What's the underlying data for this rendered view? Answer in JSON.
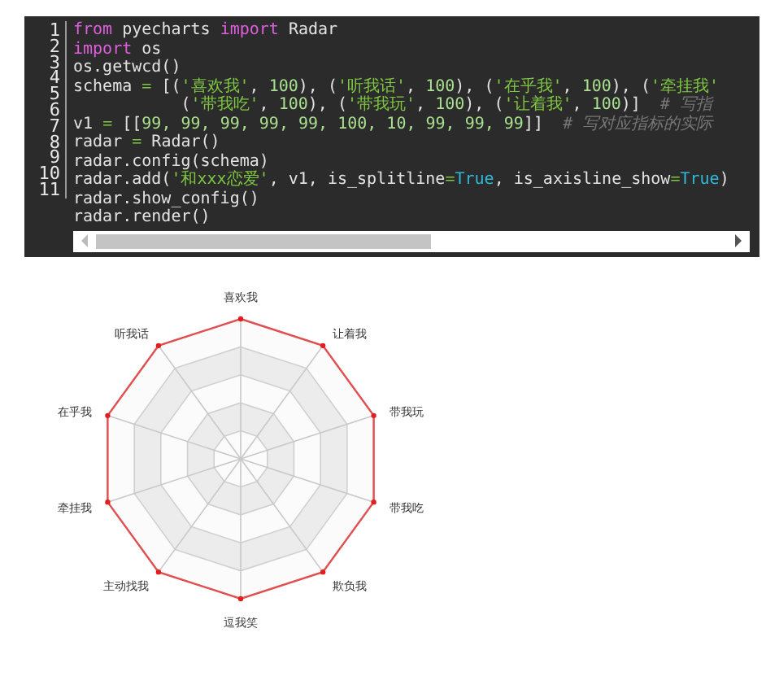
{
  "code_editor": {
    "line_numbers": [
      "1",
      "2",
      "3",
      "4",
      "5",
      "6",
      "7",
      "8",
      "9",
      "10",
      "11"
    ],
    "lines": [
      {
        "tokens": [
          {
            "text": "from",
            "kind": "keyword"
          },
          {
            "text": " pyecharts ",
            "kind": "plain"
          },
          {
            "text": "import",
            "kind": "keyword"
          },
          {
            "text": " Radar",
            "kind": "plain"
          }
        ]
      },
      {
        "tokens": [
          {
            "text": "import",
            "kind": "keyword"
          },
          {
            "text": " os",
            "kind": "plain"
          }
        ]
      },
      {
        "tokens": [
          {
            "text": "os.getwcd()",
            "kind": "plain"
          }
        ]
      },
      {
        "tokens": [
          {
            "text": "schema ",
            "kind": "plain"
          },
          {
            "text": "=",
            "kind": "operator"
          },
          {
            "text": " [(",
            "kind": "plain"
          },
          {
            "text": "'喜欢我'",
            "kind": "string"
          },
          {
            "text": ", ",
            "kind": "plain"
          },
          {
            "text": "100",
            "kind": "number"
          },
          {
            "text": "), (",
            "kind": "plain"
          },
          {
            "text": "'听我话'",
            "kind": "string"
          },
          {
            "text": ", ",
            "kind": "plain"
          },
          {
            "text": "100",
            "kind": "number"
          },
          {
            "text": "), (",
            "kind": "plain"
          },
          {
            "text": "'在乎我'",
            "kind": "string"
          },
          {
            "text": ", ",
            "kind": "plain"
          },
          {
            "text": "100",
            "kind": "number"
          },
          {
            "text": "), (",
            "kind": "plain"
          },
          {
            "text": "'牵挂我'",
            "kind": "string"
          }
        ]
      },
      {
        "tokens": [
          {
            "text": "           (",
            "kind": "plain"
          },
          {
            "text": "'带我吃'",
            "kind": "string"
          },
          {
            "text": ", ",
            "kind": "plain"
          },
          {
            "text": "100",
            "kind": "number"
          },
          {
            "text": "), (",
            "kind": "plain"
          },
          {
            "text": "'带我玩'",
            "kind": "string"
          },
          {
            "text": ", ",
            "kind": "plain"
          },
          {
            "text": "100",
            "kind": "number"
          },
          {
            "text": "), (",
            "kind": "plain"
          },
          {
            "text": "'让着我'",
            "kind": "string"
          },
          {
            "text": ", ",
            "kind": "plain"
          },
          {
            "text": "100",
            "kind": "number"
          },
          {
            "text": ")]  ",
            "kind": "plain"
          },
          {
            "text": "# 写指",
            "kind": "comment"
          }
        ]
      },
      {
        "tokens": [
          {
            "text": "v1 ",
            "kind": "plain"
          },
          {
            "text": "=",
            "kind": "operator"
          },
          {
            "text": " [[",
            "kind": "plain"
          },
          {
            "text": "99, 99, 99, 99, 99, 100, 10, 99, 99, 99",
            "kind": "number"
          },
          {
            "text": "]]  ",
            "kind": "plain"
          },
          {
            "text": "# 写对应指标的实际",
            "kind": "comment"
          }
        ]
      },
      {
        "tokens": [
          {
            "text": "radar ",
            "kind": "plain"
          },
          {
            "text": "=",
            "kind": "operator"
          },
          {
            "text": " Radar()",
            "kind": "plain"
          }
        ]
      },
      {
        "tokens": [
          {
            "text": "radar.config(schema)",
            "kind": "plain"
          }
        ]
      },
      {
        "tokens": [
          {
            "text": "radar.add(",
            "kind": "plain"
          },
          {
            "text": "'和xxx恋爱'",
            "kind": "string"
          },
          {
            "text": ", v1, is_splitline",
            "kind": "plain"
          },
          {
            "text": "=",
            "kind": "operator"
          },
          {
            "text": "True",
            "kind": "bool"
          },
          {
            "text": ", is_axisline_show",
            "kind": "plain"
          },
          {
            "text": "=",
            "kind": "operator"
          },
          {
            "text": "True",
            "kind": "bool"
          },
          {
            "text": ")",
            "kind": "plain"
          }
        ]
      },
      {
        "tokens": [
          {
            "text": "radar.show_config()",
            "kind": "plain"
          }
        ]
      },
      {
        "tokens": [
          {
            "text": "radar.render()",
            "kind": "plain"
          }
        ]
      }
    ]
  },
  "radar_chart": {
    "axis_labels": [
      "喜欢我",
      "让着我",
      "带我玩",
      "带我吃",
      "欺负我",
      "逗我笑",
      "主动找我",
      "牵挂我",
      "在乎我",
      "听我话"
    ]
  }
}
